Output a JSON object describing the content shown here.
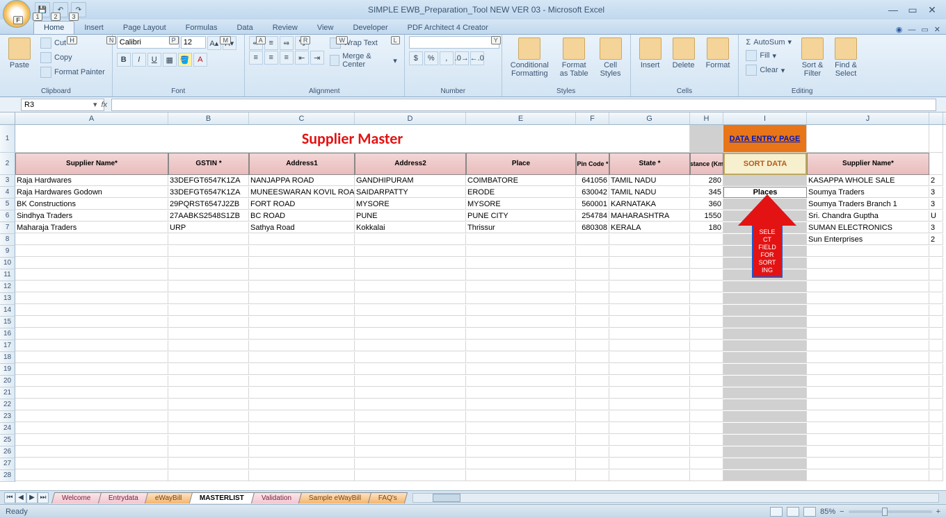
{
  "app_title": "SIMPLE EWB_Preparation_Tool NEW VER 03 - Microsoft Excel",
  "qat": {
    "save": "💾",
    "undo": "↶",
    "redo": "↷"
  },
  "tabs": {
    "home": "Home",
    "insert": "Insert",
    "page_layout": "Page Layout",
    "formulas": "Formulas",
    "data": "Data",
    "review": "Review",
    "view": "View",
    "developer": "Developer",
    "pdf": "PDF Architect 4 Creator"
  },
  "tabkeys": {
    "file": "F",
    "home": "H",
    "insert": "N",
    "page": "P",
    "formula": "M",
    "data": "A",
    "review": "R",
    "view": "W",
    "dev": "L",
    "y": "Y"
  },
  "clipboard": {
    "paste": "Paste",
    "cut": "Cut",
    "copy": "Copy",
    "painter": "Format Painter",
    "label": "Clipboard"
  },
  "font": {
    "name": "Calibri",
    "size": "12",
    "label": "Font",
    "bold": "B",
    "italic": "I",
    "underline": "U"
  },
  "alignment": {
    "wrap": "Wrap Text",
    "merge": "Merge & Center",
    "label": "Alignment"
  },
  "number": {
    "label": "Number"
  },
  "styles": {
    "cond": "Conditional\nFormatting",
    "fmt": "Format\nas Table",
    "cell": "Cell\nStyles",
    "label": "Styles"
  },
  "cells": {
    "insert": "Insert",
    "delete": "Delete",
    "format": "Format",
    "label": "Cells"
  },
  "editing": {
    "autosum": "AutoSum",
    "fill": "Fill",
    "clear": "Clear",
    "sort": "Sort &\nFilter",
    "find": "Find &\nSelect",
    "label": "Editing"
  },
  "namebox": "R3",
  "fx": "fx",
  "cols": [
    "A",
    "B",
    "C",
    "D",
    "E",
    "F",
    "G",
    "H",
    "I",
    "J"
  ],
  "sheet_title": "Supplier Master",
  "data_entry_link": "DATA ENTRY PAGE",
  "sort_data": "SORT DATA",
  "places_label": "Places",
  "arrow_text": "SELECT FIELD FOR SORTING",
  "headers": {
    "supplier": "Supplier Name*",
    "gstin": "GSTIN *",
    "addr1": "Address1",
    "addr2": "Address2",
    "place": "Place",
    "pin": "Pin Code *",
    "state": "State *",
    "dist": "Distance (Km) *",
    "supplier2": "Supplier Name*"
  },
  "rows": [
    {
      "a": "Raja Hardwares",
      "b": "33DEFGT6547K1ZA",
      "c": "NANJAPPA ROAD",
      "d": "GANDHIPURAM",
      "e": "COIMBATORE",
      "f": "641056",
      "g": "TAMIL NADU",
      "h": "280",
      "j": "KASAPPA WHOLE SALE",
      "k": "2"
    },
    {
      "a": "Raja Hardwares Godown",
      "b": "33DEFGT6547K1ZA",
      "c": "MUNEESWARAN KOVIL ROAD",
      "d": "SAIDARPATTY",
      "e": "ERODE",
      "f": "630042",
      "g": "TAMIL NADU",
      "h": "345",
      "j": "Soumya Traders",
      "k": "3"
    },
    {
      "a": "BK Constructions",
      "b": "29PQRST6547J2ZB",
      "c": "FORT ROAD",
      "d": "MYSORE",
      "e": "MYSORE",
      "f": "560001",
      "g": "KARNATAKA",
      "h": "360",
      "j": "Soumya Traders Branch 1",
      "k": "3"
    },
    {
      "a": "Sindhya Traders",
      "b": "27AABKS2548S1ZB",
      "c": "BC ROAD",
      "d": "PUNE",
      "e": "PUNE CITY",
      "f": "254784",
      "g": "MAHARASHTRA",
      "h": "1550",
      "j": "Sri. Chandra Guptha",
      "k": "U"
    },
    {
      "a": "Maharaja Traders",
      "b": "URP",
      "c": "Sathya Road",
      "d": "Kokkalai",
      "e": "Thrissur",
      "f": "680308",
      "g": "KERALA",
      "h": "180",
      "j": "SUMAN ELECTRONICS",
      "k": "3"
    }
  ],
  "extra_j": {
    "j": "Sun Enterprises",
    "k": "2"
  },
  "sheets": {
    "welcome": "Welcome",
    "entry": "Entrydata",
    "eway": "eWayBill",
    "master": "MASTERLIST",
    "valid": "Validation",
    "sample": "Sample eWayBill",
    "faq": "FAQ's"
  },
  "status": {
    "ready": "Ready",
    "zoom": "85%"
  }
}
